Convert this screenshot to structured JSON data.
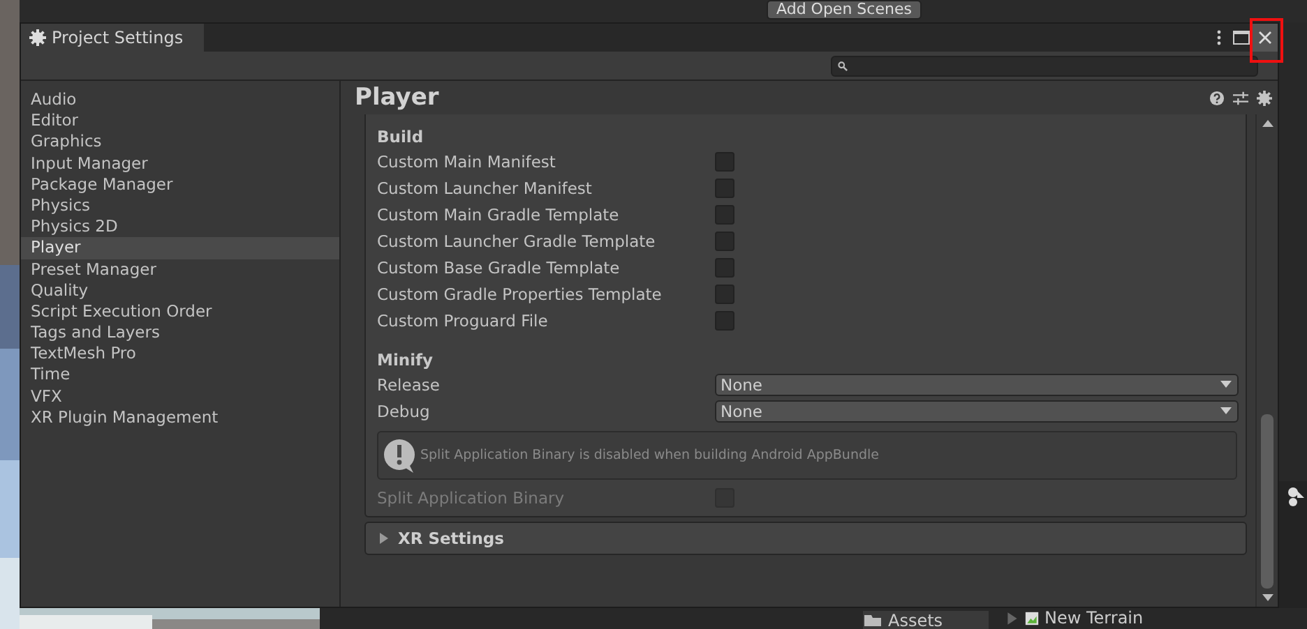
{
  "editor_background": {
    "top_button": "Add Open Scenes",
    "assets_folder": "Assets",
    "asset_item": "New Terrain"
  },
  "window": {
    "tab_title": "Project Settings"
  },
  "sidebar": {
    "items": [
      {
        "label": "Audio",
        "selected": false
      },
      {
        "label": "Editor",
        "selected": false
      },
      {
        "label": "Graphics",
        "selected": false
      },
      {
        "label": "Input Manager",
        "selected": false
      },
      {
        "label": "Package Manager",
        "selected": false
      },
      {
        "label": "Physics",
        "selected": false
      },
      {
        "label": "Physics 2D",
        "selected": false
      },
      {
        "label": "Player",
        "selected": true
      },
      {
        "label": "Preset Manager",
        "selected": false
      },
      {
        "label": "Quality",
        "selected": false
      },
      {
        "label": "Script Execution Order",
        "selected": false
      },
      {
        "label": "Tags and Layers",
        "selected": false
      },
      {
        "label": "TextMesh Pro",
        "selected": false
      },
      {
        "label": "Time",
        "selected": false
      },
      {
        "label": "VFX",
        "selected": false
      },
      {
        "label": "XR Plugin Management",
        "selected": false
      }
    ]
  },
  "panel": {
    "title": "Player",
    "sections": [
      {
        "kind": "checkboxes",
        "title": "Build",
        "rows": [
          {
            "label": "Custom Main Manifest",
            "checked": false
          },
          {
            "label": "Custom Launcher Manifest",
            "checked": false
          },
          {
            "label": "Custom Main Gradle Template",
            "checked": false
          },
          {
            "label": "Custom Launcher Gradle Template",
            "checked": false
          },
          {
            "label": "Custom Base Gradle Template",
            "checked": false
          },
          {
            "label": "Custom Gradle Properties Template",
            "checked": false
          },
          {
            "label": "Custom Proguard File",
            "checked": false
          }
        ]
      },
      {
        "kind": "dropdowns",
        "title": "Minify",
        "rows": [
          {
            "label": "Release",
            "value": "None"
          },
          {
            "label": "Debug",
            "value": "None"
          }
        ]
      }
    ],
    "notice": "Split Application Binary is disabled when building Android AppBundle",
    "split_binary": {
      "label": "Split Application Binary",
      "checked": false,
      "disabled": true
    },
    "foldout": {
      "title": "XR Settings",
      "expanded": false
    }
  }
}
